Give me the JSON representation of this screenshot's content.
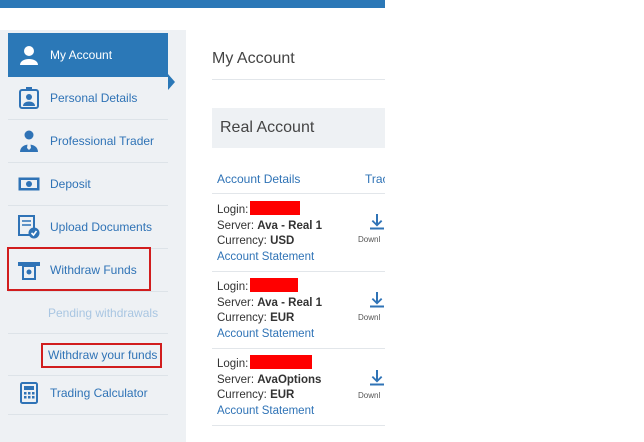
{
  "sidebar": {
    "items": [
      {
        "label": "My Account",
        "icon": "user-icon"
      },
      {
        "label": "Personal Details",
        "icon": "id-card-icon"
      },
      {
        "label": "Professional Trader",
        "icon": "trader-icon"
      },
      {
        "label": "Deposit",
        "icon": "banknote-icon"
      },
      {
        "label": "Upload Documents",
        "icon": "upload-document-icon"
      },
      {
        "label": "Withdraw Funds",
        "icon": "withdraw-icon"
      },
      {
        "label": "Trading Calculator",
        "icon": "calculator-icon"
      }
    ],
    "sub": {
      "pending": "Pending withdrawals",
      "withdraw": "Withdraw your funds"
    }
  },
  "main": {
    "title": "My Account",
    "section": "Real Account",
    "columns": [
      "Account Details",
      "Trac"
    ],
    "field_labels": {
      "login": "Login:",
      "server": "Server:",
      "currency": "Currency:"
    },
    "rows": [
      {
        "server": "Ava - Real 1",
        "currency": "USD",
        "statement": "Account Statement",
        "download": "Downl"
      },
      {
        "server": "Ava - Real 1",
        "currency": "EUR",
        "statement": "Account Statement",
        "download": "Downl"
      },
      {
        "server": "AvaOptions",
        "currency": "EUR",
        "statement": "Account Statement",
        "download": "Downl"
      }
    ]
  },
  "colors": {
    "accent": "#2b78b7",
    "highlight": "#d11d1d",
    "redaction": "#ff0000"
  }
}
